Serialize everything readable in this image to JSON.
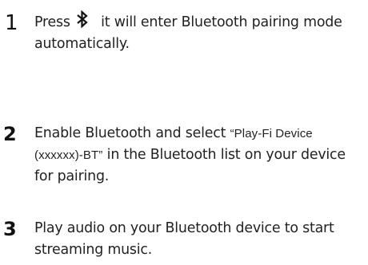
{
  "steps": [
    {
      "number": "1",
      "text_before_icon": "Press",
      "icon": "bluetooth-icon",
      "text_after_icon": "it will enter Bluetooth pairing mode automatically."
    },
    {
      "number": "2",
      "text_before_quote": "Enable Bluetooth and select ",
      "quoted_name": "“Play-Fi Device (xxxxxx)-BT”",
      "text_after_quote": " in the Bluetooth list on your device for pairing."
    },
    {
      "number": "3",
      "text": "Play audio on your Bluetooth device to start streaming music."
    }
  ]
}
